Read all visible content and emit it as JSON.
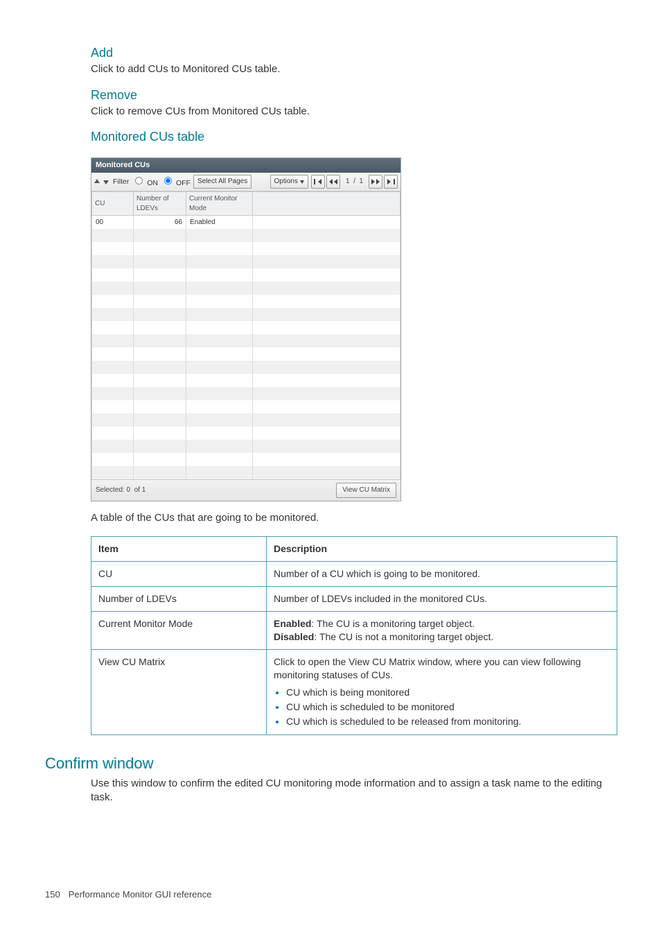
{
  "sections": {
    "add": {
      "title": "Add",
      "text": "Click to add CUs to Monitored CUs table."
    },
    "remove": {
      "title": "Remove",
      "text": "Click to remove CUs from Monitored CUs table."
    },
    "monitored": {
      "title": "Monitored CUs table"
    },
    "confirm": {
      "title": "Confirm window",
      "text": "Use this window to confirm the edited CU monitoring mode information and to assign a task name to the editing task."
    }
  },
  "panel": {
    "title": "Monitored CUs",
    "toolbar": {
      "filter_label": "Filter",
      "on_label": "ON",
      "off_label": "OFF",
      "select_all_label": "Select All Pages",
      "options_label": "Options",
      "page_indicator_current": "1",
      "page_indicator_sep": "/",
      "page_indicator_total": "1"
    },
    "columns": {
      "cu": "CU",
      "ldevs": "Number of LDEVs",
      "mode": "Current Monitor Mode"
    },
    "rows": [
      {
        "cu": "00",
        "ldevs": "66",
        "mode": "Enabled"
      }
    ],
    "blank_row_count": 19,
    "footer": {
      "selected_label": "Selected:",
      "selected_value": "0",
      "of_label": "of",
      "total_value": "1",
      "view_matrix_label": "View CU Matrix"
    }
  },
  "caption": "A table of the CUs that are going to be monitored.",
  "desc_table": {
    "headers": {
      "item": "Item",
      "description": "Description"
    },
    "rows": [
      {
        "item": "CU",
        "description_plain": "Number of a CU which is going to be monitored."
      },
      {
        "item": "Number of LDEVs",
        "description_plain": "Number of LDEVs included in the monitored CUs."
      },
      {
        "item": "Current Monitor Mode",
        "enabled_label": "Enabled",
        "enabled_text": ": The CU is a monitoring target object.",
        "disabled_label": "Disabled",
        "disabled_text": ": The CU is not a monitoring target object."
      },
      {
        "item": "View CU Matrix",
        "lead": "Click to open the View CU Matrix window, where you can view following monitoring statuses of CUs.",
        "bullets": [
          "CU which is being monitored",
          "CU which is scheduled to be monitored",
          "CU which is scheduled to be released from monitoring."
        ]
      }
    ]
  },
  "page_footer": {
    "number": "150",
    "title": "Performance Monitor GUI reference"
  }
}
